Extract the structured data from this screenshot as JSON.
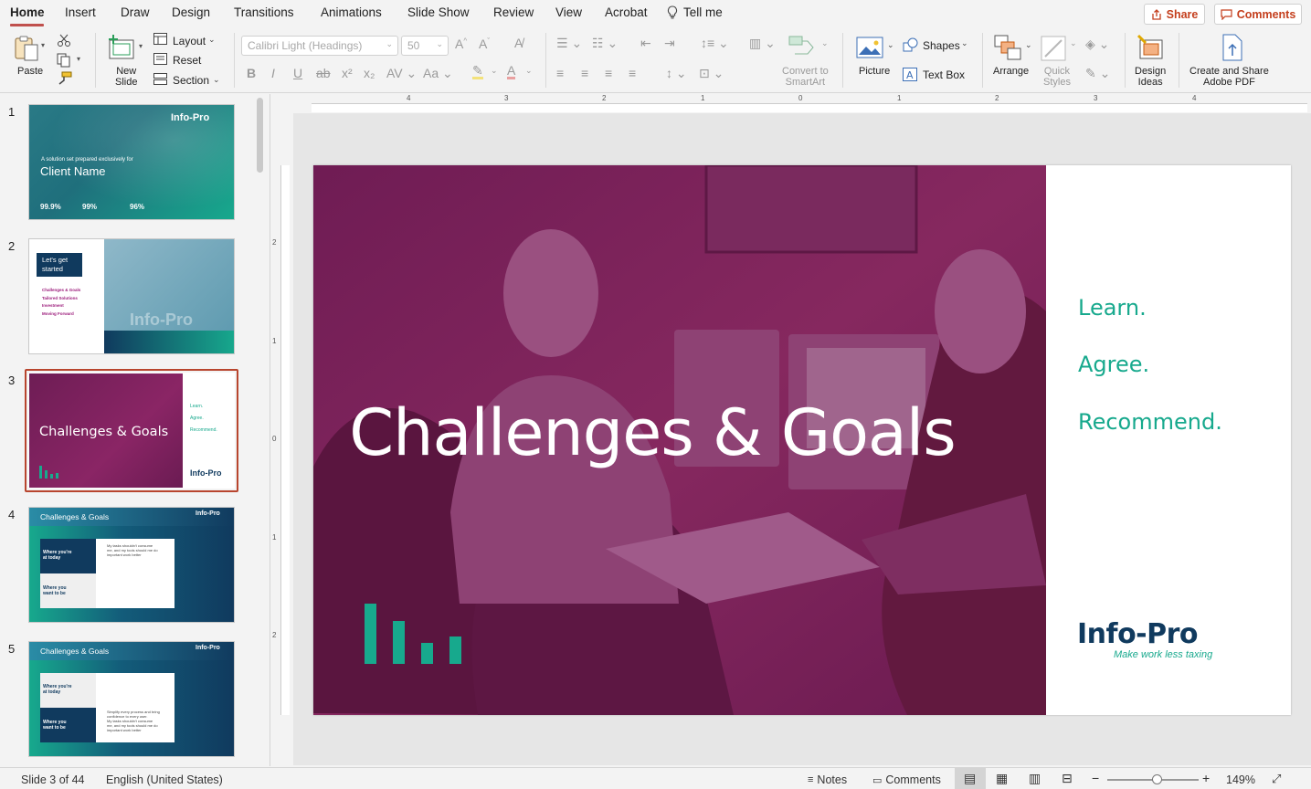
{
  "tabs": [
    {
      "label": "Home",
      "active": true
    },
    {
      "label": "Insert"
    },
    {
      "label": "Draw"
    },
    {
      "label": "Design"
    },
    {
      "label": "Transitions"
    },
    {
      "label": "Animations"
    },
    {
      "label": "Slide Show"
    },
    {
      "label": "Review"
    },
    {
      "label": "View"
    },
    {
      "label": "Acrobat"
    }
  ],
  "tell_me": {
    "label": "Tell me",
    "icon": "lightbulb-icon"
  },
  "share_label": "Share",
  "comments_label": "Comments",
  "ribbon": {
    "paste": "Paste",
    "new_slide": [
      "New",
      "Slide"
    ],
    "layout": "Layout",
    "reset": "Reset",
    "section": "Section",
    "font_name_placeholder": "Calibri Light (Headings)",
    "font_size": "50",
    "convert_smartart": [
      "Convert to",
      "SmartArt"
    ],
    "picture": "Picture",
    "shapes": "Shapes",
    "text_box": "Text Box",
    "arrange": "Arrange",
    "quick_styles": [
      "Quick",
      "Styles"
    ],
    "design_ideas": [
      "Design",
      "Ideas"
    ],
    "create_share_pdf": [
      "Create and Share",
      "Adobe PDF"
    ]
  },
  "thumbnails": [
    {
      "num": "1",
      "line1": "A solution set prepared exclusively for",
      "title": "Client Name",
      "stats": [
        "99.9%",
        "99%",
        "96%"
      ]
    },
    {
      "num": "2",
      "title": [
        "Let's get",
        "started"
      ],
      "items": [
        "Challenges & Goals",
        "Tailored Solutions",
        "Investment",
        "Moving Forward"
      ]
    },
    {
      "num": "3",
      "title": "Challenges & Goals",
      "items": [
        "Learn.",
        "Agree.",
        "Recommend."
      ],
      "selected": true
    },
    {
      "num": "4",
      "title": "Challenges & Goals",
      "row1": [
        "Where you're",
        "at today"
      ],
      "row2": [
        "Where you",
        "want to be"
      ],
      "bullet": [
        "My tasks shouldn't consume",
        "me, and my tools should me do",
        "important work better"
      ]
    },
    {
      "num": "5",
      "title": "Challenges & Goals",
      "row1": [
        "Where you're",
        "at today"
      ],
      "row2": [
        "Where you",
        "want to be"
      ],
      "bullet1": [
        "Simplify every process and bring",
        "confidence to every user."
      ],
      "bullet2": [
        "My tasks shouldn't consume",
        "me, and my tools should me do",
        "important work better"
      ]
    }
  ],
  "logo_text": "Info-Pro",
  "slide": {
    "title": "Challenges & Goals",
    "motto": [
      "Learn.",
      "Agree.",
      "Recommend."
    ],
    "logo_text": "Info-Pro",
    "logo_tagline": "Make work less taxing",
    "accent_color": "#17a98d",
    "overlay_color": "#7b1e5c"
  },
  "hruler_labels": [
    "4",
    "3",
    "2",
    "1",
    "0",
    "1",
    "2",
    "3",
    "4"
  ],
  "vruler_labels": [
    "2",
    "1",
    "0",
    "1",
    "2"
  ],
  "status": {
    "slide_info": "Slide 3 of 44",
    "language": "English (United States)",
    "notes": "Notes",
    "comments": "Comments",
    "zoom": "149%"
  }
}
